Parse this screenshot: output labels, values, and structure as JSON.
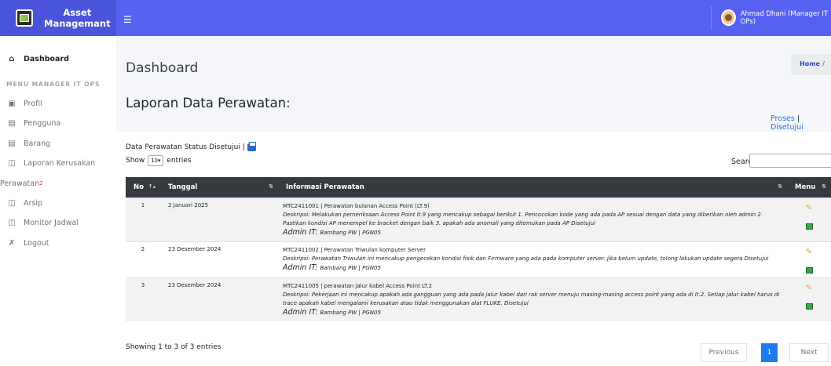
{
  "brand": {
    "line1": "Asset",
    "line2": "Managemant"
  },
  "sidebar": {
    "dashboard": "Dashboard",
    "heading": "MENU MANAGER IT OPS",
    "items": [
      {
        "label": "Profil",
        "icon": "calendar-icon"
      },
      {
        "label": "Pengguna",
        "icon": "list-icon"
      },
      {
        "label": "Barang",
        "icon": "list-icon"
      },
      {
        "label": "Laporan Kerusakan",
        "icon": "table-icon"
      }
    ],
    "perawatan": {
      "label": "Perawatan",
      "badge": "2"
    },
    "items2": [
      {
        "label": "Arsip",
        "icon": "table-icon"
      },
      {
        "label": "Monitor Jadwal",
        "icon": "table-icon"
      }
    ],
    "logout": "Logout"
  },
  "topbar": {
    "user": "Ahmad Dhani (Manager IT OPs)"
  },
  "page": {
    "title": "Dashboard",
    "breadcrumb_home": "Home",
    "breadcrumb_sep": "/",
    "report_title": "Laporan Data Perawatan:",
    "filter_proses": "Proses",
    "filter_sep": "|",
    "filter_disetujui": "Disetujui",
    "caption": "Data Perawatan Status Disetujui |",
    "show": "Show",
    "entries_value": "10",
    "entries": "entries",
    "search": "Search:"
  },
  "table": {
    "headers": {
      "no": "No",
      "tanggal": "Tanggal",
      "info": "Informasi Perawatan",
      "menu": "Menu"
    },
    "rows": [
      {
        "no": "1",
        "tanggal": "2 Januari 2025",
        "head": "MTC2411001 | Perawatan bulanan Access Point (LT.9)",
        "desc": "Deskripsi: Melakukan pemeriksaan Access Point lt.9 yang mencakup sebagai berikut 1. Pencocokan kode yang ada pada AP sesuai dengan data yang diberikan oleh admin 2. Pastikan kondisi AP menempel ke bracket dengan baik 3. apakah ada anomali yang ditemukan pada AP Disetujui",
        "admin_label": "Admin IT:",
        "admin": "Bambang PW | PGN05"
      },
      {
        "no": "2",
        "tanggal": "23 Desember 2024",
        "head": "MTC2411002 | Perawatan Triwulan komputer Server",
        "desc": "Deskripsi: Perawatan Triwulan ini mencakup pengecekan kondisi fisik dan Firmware yang ada pada komputer server. jika belum update, tolong lakukan update segera Disetujui",
        "admin_label": "Admin IT:",
        "admin": "Bambang PW | PGN05"
      },
      {
        "no": "3",
        "tanggal": "23 Desember 2024",
        "head": "MTC2411005 | perawatan jalur kabel Access Point LT.2",
        "desc": "Deskripsi: Pekerjaan ini mencakup apakah ada gangguan yang ada pada jalur kabel dari rak server menuju masing-masing access point yang ada di lt.2. Setiap jalur kabel harus di trace apakah kabel mengalami kerusakan atau tidak menggunakan alat FLUKE. Disetujui",
        "admin_label": "Admin IT:",
        "admin": "Bambang PW | PGN05"
      }
    ]
  },
  "footer": {
    "showing": "Showing 1 to 3 of 3 entries",
    "previous": "Previous",
    "page": "1",
    "next": "Next"
  },
  "colors": {
    "brand_bg": "#4a54d8",
    "topbar_bg": "#5761f0",
    "table_header": "#343a40",
    "link": "#2d72d9",
    "page_active": "#1f7bf2"
  }
}
